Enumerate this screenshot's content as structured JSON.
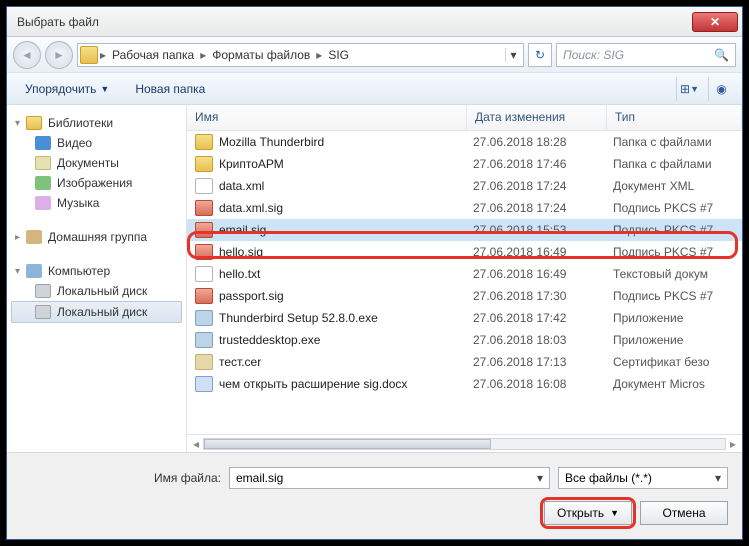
{
  "title": "Выбрать файл",
  "breadcrumbs": [
    "Рабочая папка",
    "Форматы файлов",
    "SIG"
  ],
  "search_placeholder": "Поиск: SIG",
  "toolbar": {
    "organize": "Упорядочить",
    "newfolder": "Новая папка"
  },
  "sidebar": {
    "libraries": {
      "label": "Библиотеки",
      "items": [
        "Видео",
        "Документы",
        "Изображения",
        "Музыка"
      ]
    },
    "homegroup": "Домашняя группа",
    "computer": {
      "label": "Компьютер",
      "items": [
        "Локальный диск",
        "Локальный диск"
      ]
    }
  },
  "columns": {
    "name": "Имя",
    "date": "Дата изменения",
    "type": "Тип"
  },
  "files": [
    {
      "icon": "folder",
      "name": "Mozilla Thunderbird",
      "date": "27.06.2018 18:28",
      "type": "Папка с файлами"
    },
    {
      "icon": "folder",
      "name": "КриптоАРМ",
      "date": "27.06.2018 17:46",
      "type": "Папка с файлами"
    },
    {
      "icon": "xml",
      "name": "data.xml",
      "date": "27.06.2018 17:24",
      "type": "Документ XML"
    },
    {
      "icon": "sig",
      "name": "data.xml.sig",
      "date": "27.06.2018 17:24",
      "type": "Подпись PKCS #7"
    },
    {
      "icon": "sig",
      "name": "email.sig",
      "date": "27.06.2018 15:53",
      "type": "Подпись PKCS #7",
      "selected": true
    },
    {
      "icon": "sig",
      "name": "hello.sig",
      "date": "27.06.2018 16:49",
      "type": "Подпись PKCS #7"
    },
    {
      "icon": "txt",
      "name": "hello.txt",
      "date": "27.06.2018 16:49",
      "type": "Текстовый докум"
    },
    {
      "icon": "sig",
      "name": "passport.sig",
      "date": "27.06.2018 17:30",
      "type": "Подпись PKCS #7"
    },
    {
      "icon": "exe",
      "name": "Thunderbird Setup 52.8.0.exe",
      "date": "27.06.2018 17:42",
      "type": "Приложение"
    },
    {
      "icon": "exe",
      "name": "trusteddesktop.exe",
      "date": "27.06.2018 18:03",
      "type": "Приложение"
    },
    {
      "icon": "cer",
      "name": "тест.cer",
      "date": "27.06.2018 17:13",
      "type": "Сертификат безо"
    },
    {
      "icon": "docx",
      "name": "чем открыть расширение sig.docx",
      "date": "27.06.2018 16:08",
      "type": "Документ Micros"
    }
  ],
  "footer": {
    "filename_label": "Имя файла:",
    "filename_value": "email.sig",
    "filter": "Все файлы (*.*)",
    "open": "Открыть",
    "cancel": "Отмена"
  }
}
